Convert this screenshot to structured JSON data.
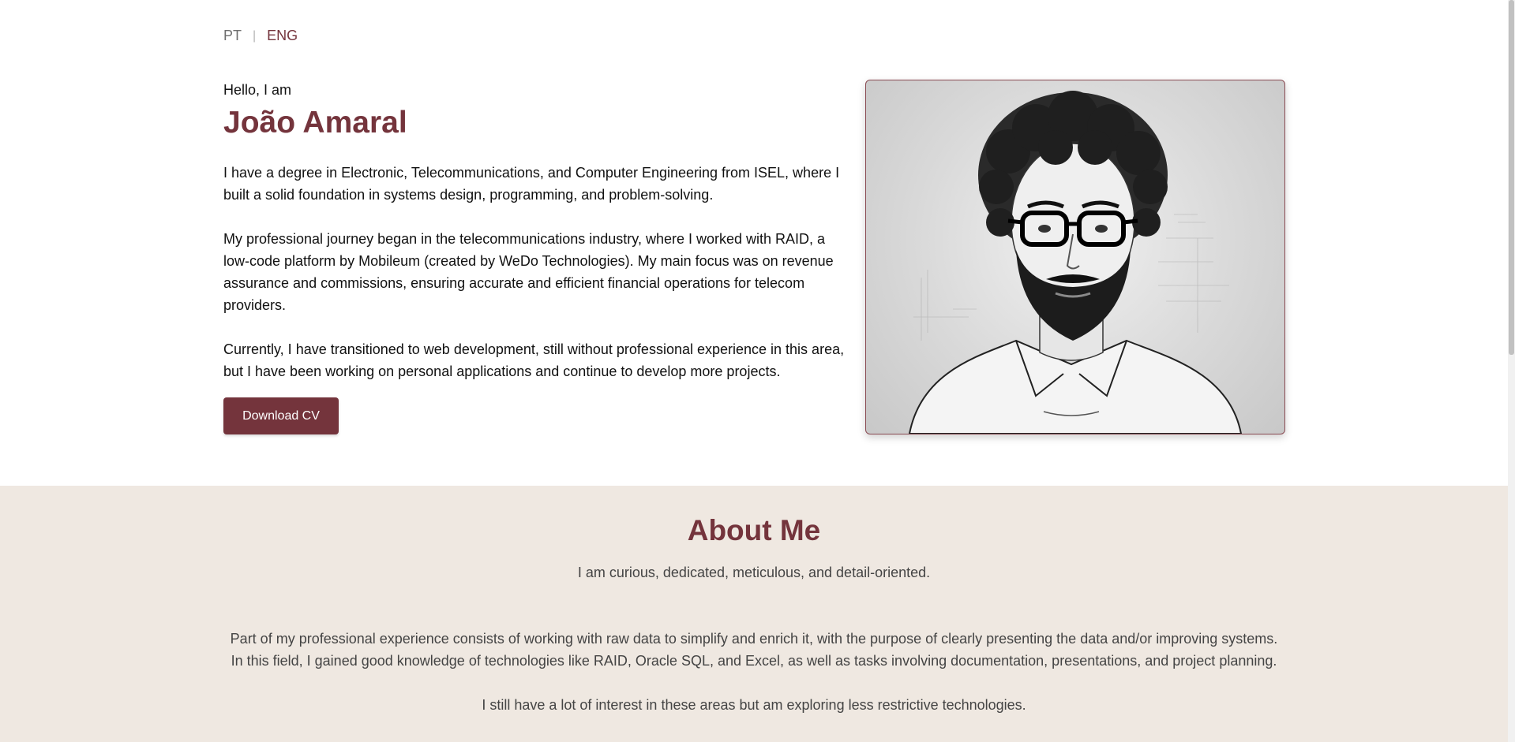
{
  "lang": {
    "pt": "PT",
    "separator": "|",
    "eng": "ENG"
  },
  "hero": {
    "greeting": "Hello, I am",
    "name": "João Amaral",
    "bio": [
      "I have a degree in Electronic, Telecommunications, and Computer Engineering from ISEL, where I built a solid foundation in systems design, programming, and problem-solving.",
      "My professional journey began in the telecommunications industry, where I worked with RAID, a low-code platform by Mobileum (created by WeDo Technologies). My main focus was on revenue assurance and commissions, ensuring accurate and efficient financial operations for telecom providers.",
      "Currently, I have transitioned to web development, still without professional experience in this area, but I have been working on personal applications and continue to develop more projects."
    ],
    "download_label": "Download CV"
  },
  "about": {
    "title": "About Me",
    "tagline": "I am curious, dedicated, meticulous, and detail-oriented.",
    "paragraphs": [
      "Part of my professional experience consists of working with raw data to simplify and enrich it, with the purpose of clearly presenting the data and/or improving systems. In this field, I gained good knowledge of technologies like RAID, Oracle SQL, and Excel, as well as tasks involving documentation, presentations, and project planning.",
      "I still have a lot of interest in these areas but am exploring less restrictive technologies."
    ]
  },
  "colors": {
    "accent": "#74343c",
    "about_bg": "#efe8e1",
    "text": "#111111",
    "muted": "#444444"
  }
}
